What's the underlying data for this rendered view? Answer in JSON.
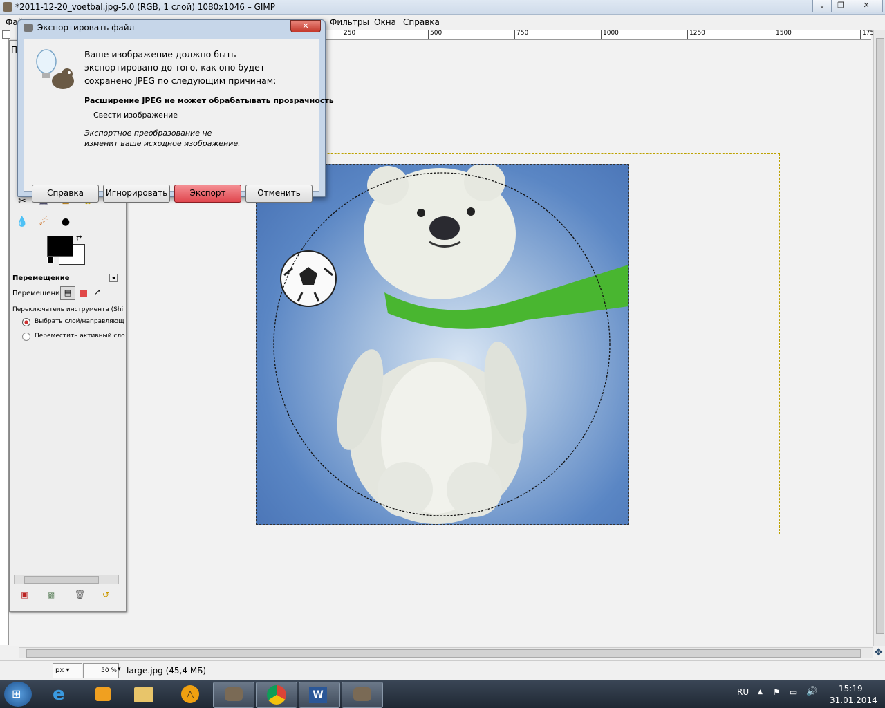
{
  "window": {
    "title": "*2011-12-20_voetbal.jpg-5.0 (RGB, 1 слой) 1080x1046 – GIMP"
  },
  "menu": {
    "file": "Фай",
    "filters": "Фильтры",
    "windows": "Окна",
    "help": "Справка"
  },
  "ruler": {
    "ticks": [
      "250",
      "500",
      "750",
      "1000",
      "1250",
      "1500",
      "175"
    ]
  },
  "dialog": {
    "title": "Экспортировать файл",
    "message": "Ваше изображение должно быть экспортировано до того, как оно будет сохранено JPEG по следующим причинам:",
    "reason_heading": "Расширение JPEG не может обрабатывать прозрачность",
    "reason_item": "Свести изображение",
    "note": "Экспортное преобразование не изменит ваше исходное изображение.",
    "buttons": {
      "help": "Справка",
      "ignore": "Игнорировать",
      "export": "Экспорт",
      "cancel": "Отменить"
    }
  },
  "toolbox": {
    "header_letter": "П",
    "options_title": "Перемещение",
    "move_label": "Перемещение:",
    "tool_toggle": "Переключатель инструмента  (Shi",
    "option_pick": "Выбрать слой/направляющ",
    "option_move_active": "Переместить активный сло"
  },
  "status": {
    "unit": "px",
    "zoom": "50 %",
    "file_info": "large.jpg (45,4 МБ)"
  },
  "taskbar": {
    "lang": "RU",
    "time": "15:19",
    "date": "31.01.2014"
  },
  "colors": {
    "export_button": "#e0464e",
    "taskbar": "#1f2833",
    "scarf": "#49b630",
    "image_bg": "#4f7dbf"
  }
}
